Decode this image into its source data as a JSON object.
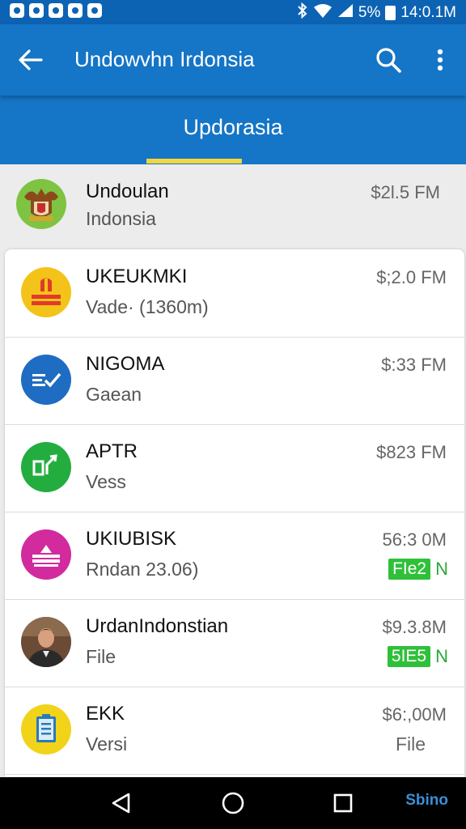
{
  "status_bar": {
    "time": "14:0.1M",
    "battery": "5%"
  },
  "header": {
    "title": "Undowvhn Irdonsia"
  },
  "tabs": [
    {
      "label": "Updorasia",
      "selected": true
    }
  ],
  "top_item": {
    "title": "Undoulan",
    "subtitle": "Indonsia",
    "size": "$2l.5 FM"
  },
  "items": [
    {
      "title": "UKEUKMKI",
      "subtitle": "Vade· (1360m)",
      "size": "$;2.0 FM",
      "icon": "red-stripes-icon"
    },
    {
      "title": "NIGOMA",
      "subtitle": "Gaean",
      "size": "$:33 FM",
      "icon": "chat-check-icon"
    },
    {
      "title": "APTR",
      "subtitle": "Vess",
      "size": "$823 FM",
      "icon": "chart-arrow-icon"
    },
    {
      "title": "UKIUBISK",
      "subtitle": "Rndan 23.06)",
      "size": "56:3 0M",
      "status_badge": "FIe2",
      "status_letter": "N",
      "icon": "stack-icon"
    },
    {
      "title": "UrdanIndonstian",
      "subtitle": "File",
      "size": "$9.3.8M",
      "status_badge": "5IE5",
      "status_letter": "N",
      "icon": "portrait-icon"
    },
    {
      "title": "EKK",
      "subtitle": "Versi",
      "size": "$6:,00M",
      "file_label": "File",
      "icon": "clipboard-icon"
    }
  ],
  "nav": {
    "extra_label": "Sbino"
  },
  "colors": {
    "app_bar": "#1575c6",
    "status_bar": "#0d63b3",
    "tab_indicator": "#f2d53f",
    "status_badge": "#2fc03a"
  }
}
